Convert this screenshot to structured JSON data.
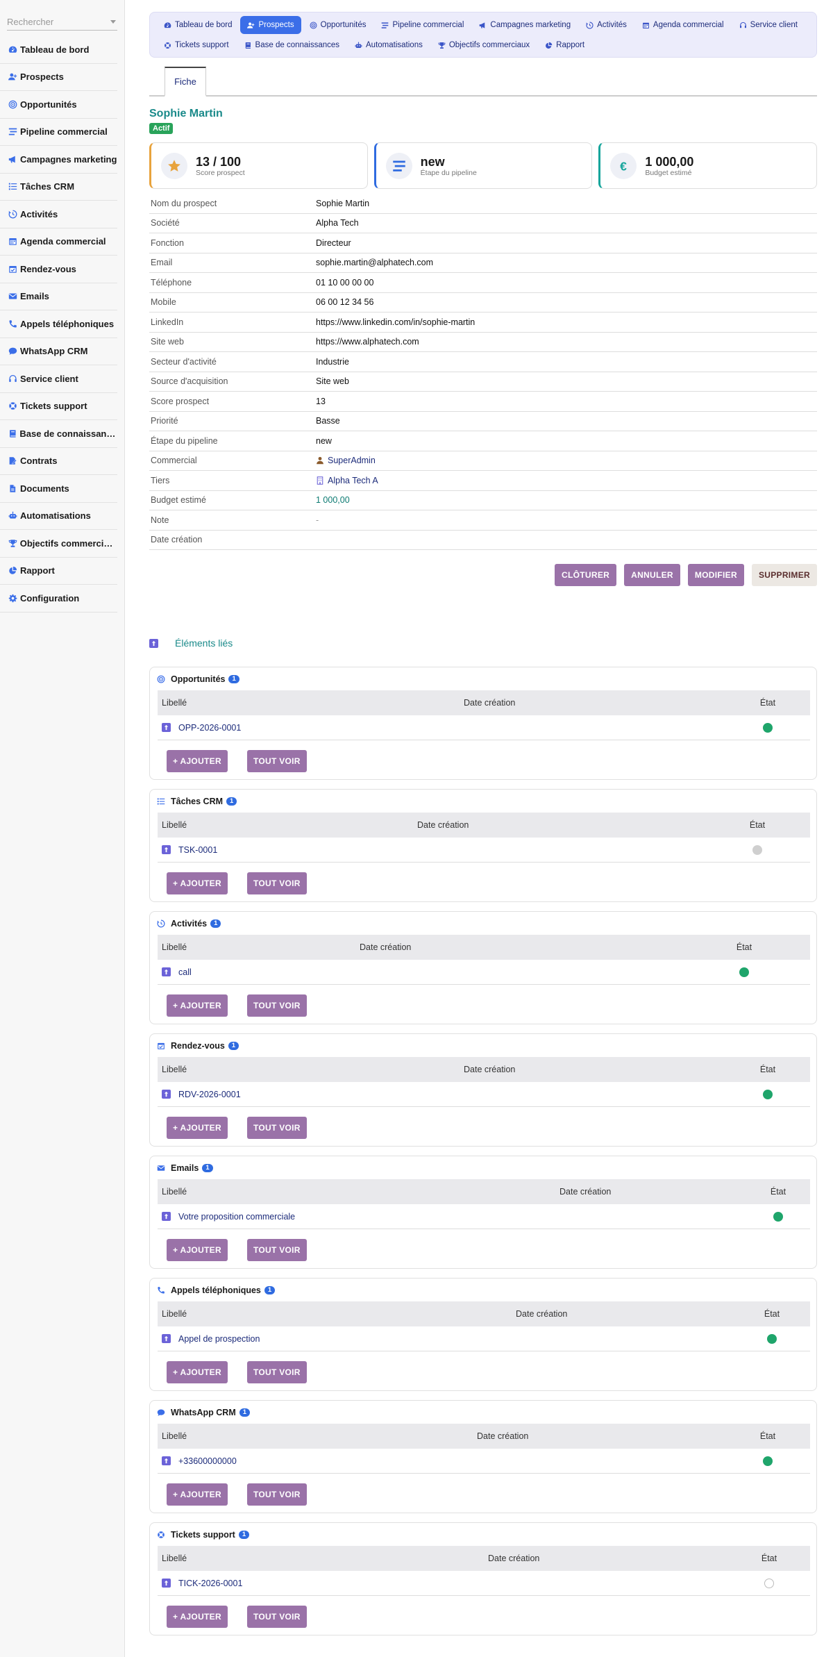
{
  "sidebar": {
    "search_placeholder": "Rechercher",
    "items": [
      {
        "label": "Tableau de bord",
        "icon": "gauge-icon"
      },
      {
        "label": "Prospects",
        "icon": "user-plus-icon"
      },
      {
        "label": "Opportunités",
        "icon": "target-icon"
      },
      {
        "label": "Pipeline commercial",
        "icon": "bars-icon"
      },
      {
        "label": "Campagnes marketing",
        "icon": "megaphone-icon"
      },
      {
        "label": "Tâches CRM",
        "icon": "list-icon"
      },
      {
        "label": "Activités",
        "icon": "history-icon"
      },
      {
        "label": "Agenda commercial",
        "icon": "calendar-icon"
      },
      {
        "label": "Rendez-vous",
        "icon": "calendar-check-icon"
      },
      {
        "label": "Emails",
        "icon": "envelope-icon"
      },
      {
        "label": "Appels téléphoniques",
        "icon": "phone-icon"
      },
      {
        "label": "WhatsApp CRM",
        "icon": "chat-icon"
      },
      {
        "label": "Service client",
        "icon": "headset-icon"
      },
      {
        "label": "Tickets support",
        "icon": "lifebuoy-icon"
      },
      {
        "label": "Base de connaissances",
        "icon": "book-icon"
      },
      {
        "label": "Contrats",
        "icon": "contract-icon"
      },
      {
        "label": "Documents",
        "icon": "folder-icon"
      },
      {
        "label": "Automatisations",
        "icon": "robot-icon"
      },
      {
        "label": "Objectifs commerciaux",
        "icon": "trophy-icon"
      },
      {
        "label": "Rapport",
        "icon": "pie-icon"
      },
      {
        "label": "Configuration",
        "icon": "gear-icon"
      }
    ]
  },
  "topnav": {
    "tabs": [
      {
        "label": "Tableau de bord",
        "active": false
      },
      {
        "label": "Prospects",
        "active": true
      },
      {
        "label": "Opportunités",
        "active": false
      },
      {
        "label": "Pipeline commercial",
        "active": false
      },
      {
        "label": "Campagnes marketing",
        "active": false
      },
      {
        "label": "Activités",
        "active": false
      },
      {
        "label": "Agenda commercial",
        "active": false
      },
      {
        "label": "Service client",
        "active": false
      },
      {
        "label": "Tickets support",
        "active": false
      },
      {
        "label": "Base de connaissances",
        "active": false
      },
      {
        "label": "Automatisations",
        "active": false
      },
      {
        "label": "Objectifs commerciaux",
        "active": false
      },
      {
        "label": "Rapport",
        "active": false
      }
    ]
  },
  "subtab": {
    "label": "Fiche"
  },
  "record": {
    "name": "Sophie Martin",
    "status": "Actif",
    "kpis": [
      {
        "value": "13 / 100",
        "label": "Score prospect",
        "icon": "star-icon",
        "color": "#e8a33d"
      },
      {
        "value": "new",
        "label": "Étape du pipeline",
        "icon": "bars-icon",
        "color": "#2f6be0"
      },
      {
        "value": "1 000,00",
        "label": "Budget estimé",
        "icon": "euro-icon",
        "color": "#15a59b"
      }
    ],
    "fields": [
      {
        "label": "Nom du prospect",
        "value": "Sophie Martin"
      },
      {
        "label": "Société",
        "value": "Alpha Tech"
      },
      {
        "label": "Fonction",
        "value": "Directeur"
      },
      {
        "label": "Email",
        "value": "sophie.martin@alphatech.com"
      },
      {
        "label": "Téléphone",
        "value": "01 10 00 00 00"
      },
      {
        "label": "Mobile",
        "value": "06 00 12 34 56"
      },
      {
        "label": "LinkedIn",
        "value": "https://www.linkedin.com/in/sophie-martin"
      },
      {
        "label": "Site web",
        "value": "https://www.alphatech.com"
      },
      {
        "label": "Secteur d'activité",
        "value": "Industrie"
      },
      {
        "label": "Source d'acquisition",
        "value": "Site web"
      },
      {
        "label": "Score prospect",
        "value": "13"
      },
      {
        "label": "Priorité",
        "value": "Basse"
      },
      {
        "label": "Étape du pipeline",
        "value": "new"
      },
      {
        "label": "Commercial",
        "value": "SuperAdmin",
        "kind": "user"
      },
      {
        "label": "Tiers",
        "value": "Alpha Tech A",
        "kind": "company"
      },
      {
        "label": "Budget estimé",
        "value": "1 000,00",
        "kind": "amount"
      },
      {
        "label": "Note",
        "value": "-",
        "kind": "muted"
      },
      {
        "label": "Date création",
        "value": ""
      }
    ]
  },
  "actions": {
    "close_label": "CLÔTURER",
    "cancel_label": "ANNULER",
    "edit_label": "MODIFIER",
    "delete_label": "SUPPRIMER"
  },
  "linked": {
    "title": "Éléments liés",
    "col_label": "Libellé",
    "col_date": "Date création",
    "col_status": "État",
    "add_label": "+ AJOUTER",
    "all_label": "TOUT VOIR",
    "sections": [
      {
        "title": "Opportunités",
        "count": "1",
        "icon": "target-icon",
        "row": "OPP-2026-0001",
        "state": "green",
        "date_col": 452,
        "state_col": 880
      },
      {
        "title": "Tâches CRM",
        "count": "1",
        "icon": "list-icon",
        "row": "TSK-0001",
        "state": "grey",
        "date_col": 385,
        "state_col": 865
      },
      {
        "title": "Activités",
        "count": "1",
        "icon": "history-icon",
        "row": "call",
        "state": "green",
        "date_col": 302,
        "state_col": 846
      },
      {
        "title": "Rendez-vous",
        "count": "1",
        "icon": "calendar-check-icon",
        "row": "RDV-2026-0001",
        "state": "green",
        "date_col": 452,
        "state_col": 880
      },
      {
        "title": "Emails",
        "count": "1",
        "icon": "envelope-icon",
        "row": "Votre proposition commerciale",
        "state": "green",
        "date_col": 590,
        "state_col": 895
      },
      {
        "title": "Appels téléphoniques",
        "count": "1",
        "icon": "phone-icon",
        "row": "Appel de prospection",
        "state": "green",
        "date_col": 527,
        "state_col": 886
      },
      {
        "title": "WhatsApp CRM",
        "count": "1",
        "icon": "chat-icon",
        "row": "+33600000000",
        "state": "green",
        "date_col": 471,
        "state_col": 880
      },
      {
        "title": "Tickets support",
        "count": "1",
        "icon": "lifebuoy-icon",
        "row": "TICK-2026-0001",
        "state": "empty",
        "date_col": 487,
        "state_col": 882
      }
    ]
  }
}
